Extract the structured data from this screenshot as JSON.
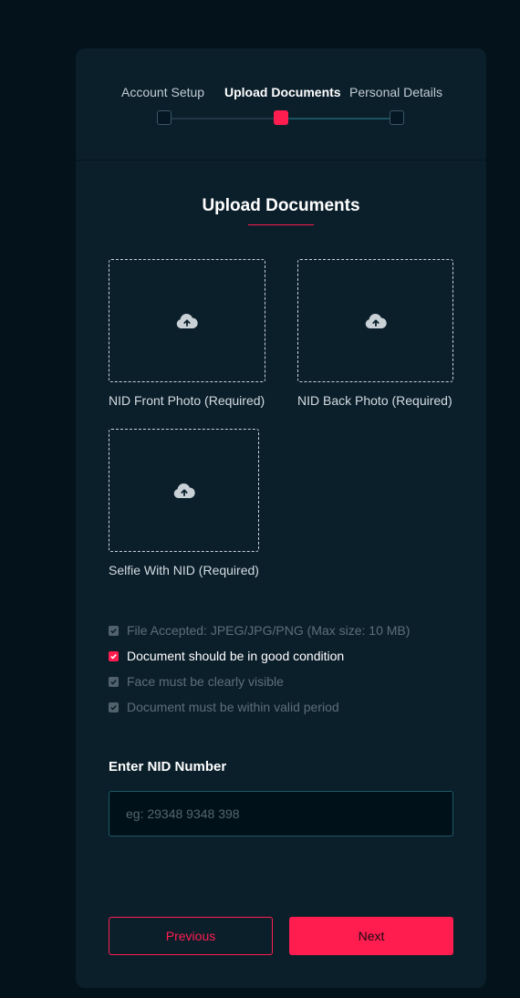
{
  "stepper": {
    "steps": [
      {
        "label": "Account Setup",
        "state": "inactive"
      },
      {
        "label": "Upload Documents",
        "state": "active"
      },
      {
        "label": "Personal Details",
        "state": "inactive"
      }
    ]
  },
  "section": {
    "title": "Upload Documents"
  },
  "uploads": [
    {
      "label": "NID Front Photo (Required)",
      "icon": "cloud-upload-icon"
    },
    {
      "label": "NID Back Photo (Required)",
      "icon": "cloud-upload-icon"
    },
    {
      "label": "Selfie With NID (Required)",
      "icon": "cloud-upload-icon"
    }
  ],
  "requirements": [
    {
      "text": "File Accepted: JPEG/JPG/PNG (Max size: 10 MB)",
      "checked": true,
      "highlight": false
    },
    {
      "text": "Document should be in good condition",
      "checked": true,
      "highlight": true
    },
    {
      "text": "Face must be clearly visible",
      "checked": true,
      "highlight": false
    },
    {
      "text": "Document must be within valid period",
      "checked": true,
      "highlight": false
    }
  ],
  "nid": {
    "label": "Enter NID Number",
    "placeholder": "eg: 29348 9348 398",
    "value": ""
  },
  "buttons": {
    "previous": "Previous",
    "next": "Next"
  },
  "colors": {
    "accent": "#ff1d50",
    "card": "#0b1f2b",
    "background": "#03121b"
  }
}
